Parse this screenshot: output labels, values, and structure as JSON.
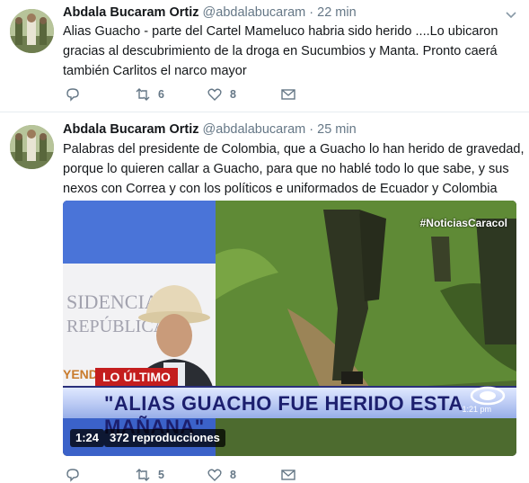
{
  "tweets": [
    {
      "author_name": "Abdala Bucaram Ortiz",
      "handle": "@abdalabucaram",
      "separator": "·",
      "time": "22 min",
      "text_lines": [
        "Alias Guacho - parte del Cartel Mameluco habria sido herido ....Lo ubicaron",
        "gracias al descubrimiento de la droga en Sucumbios y Manta. Pronto caerá",
        "también Carlitos el narco mayor"
      ],
      "actions": {
        "reply_count": "",
        "retweet_count": "6",
        "like_count": "8"
      }
    },
    {
      "author_name": "Abdala Bucaram Ortiz",
      "handle": "@abdalabucaram",
      "separator": "·",
      "time": "25 min",
      "text_lines": [
        "Palabras del presidente de Colombia, que a Guacho lo han herido de gravedad,",
        "porque lo quieren callar a Guacho, para que no hablé todo lo que sabe, y sus",
        "nexos  con Correa y con los políticos e uniformados de Ecuador y Colombia"
      ],
      "media": {
        "headline": "\"ALIAS GUACHO FUE HERIDO ESTA MAÑANA\"",
        "breaking_label": "LO ÚLTIMO",
        "hashtag": "#NoticiasCaracol",
        "clock": "1:21 pm",
        "duration": "1:24",
        "views": "372 reproducciones",
        "sign_line1": "SIDENCIA",
        "sign_line2": "REPÚBLICA",
        "sign_line3": "YEND"
      },
      "actions": {
        "reply_count": "",
        "retweet_count": "5",
        "like_count": "8"
      }
    }
  ],
  "icons": {
    "reply": "reply-icon",
    "retweet": "retweet-icon",
    "like": "heart-icon",
    "dm": "envelope-icon",
    "more": "chevron-down-icon"
  },
  "colors": {
    "text_primary": "#14171a",
    "text_secondary": "#657786",
    "ticker_blue": "#1c1f6e",
    "breaking_red": "#c41e1e"
  }
}
